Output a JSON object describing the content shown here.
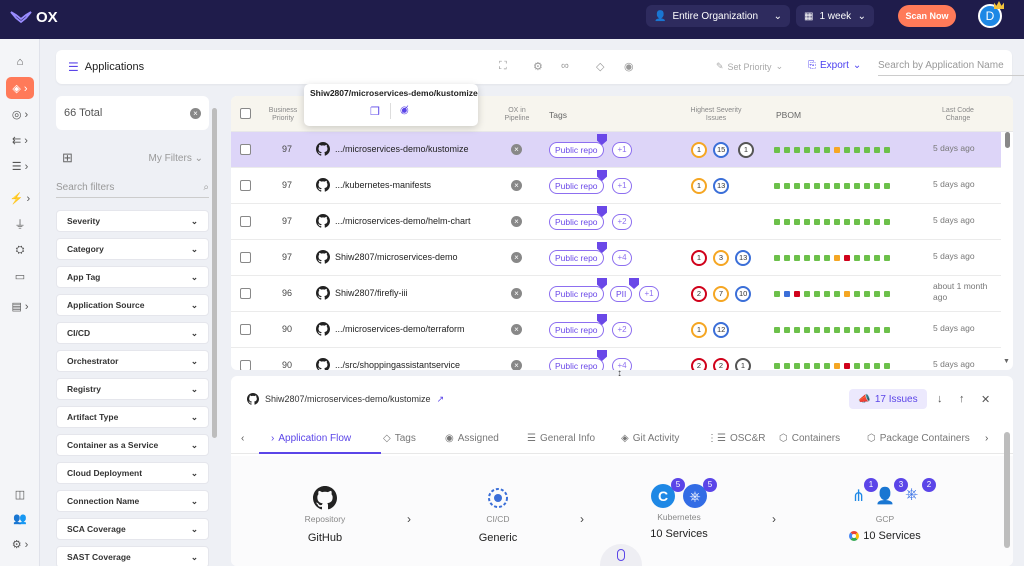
{
  "topbar": {
    "brand": "OX",
    "org_selector": "Entire Organization",
    "period_selector": "1 week",
    "scan_label": "Scan Now",
    "avatar_initial": "D"
  },
  "header": {
    "title": "Applications",
    "set_priority": "Set Priority",
    "export": "Export",
    "search_placeholder": "Search by Application Name"
  },
  "filters": {
    "total": "66 Total",
    "my_filters": "My Filters",
    "search_placeholder": "Search filters",
    "items": [
      "Severity",
      "Category",
      "App Tag",
      "Application Source",
      "CI/CD",
      "Orchestrator",
      "Registry",
      "Artifact Type",
      "Container as a Service",
      "Cloud Deployment",
      "Connection Name",
      "SCA Coverage",
      "SAST Coverage"
    ]
  },
  "table": {
    "headers": {
      "priority_l1": "Business",
      "priority_l2": "Priority",
      "pipeline_l1": "OX in",
      "pipeline_l2": "Pipeline",
      "tags": "Tags",
      "severity_l1": "Highest Severity",
      "severity_l2": "Issues",
      "pbom": "PBOM",
      "last_l1": "Last Code",
      "last_l2": "Change"
    },
    "rows": [
      {
        "priority": "97",
        "name": ".../microservices-demo/kustomize",
        "tag": "Public repo",
        "tag2": "",
        "more": "+1",
        "sev": [
          "1",
          "15",
          "1"
        ],
        "last": "5 days ago"
      },
      {
        "priority": "97",
        "name": ".../kubernetes-manifests",
        "tag": "Public repo",
        "tag2": "",
        "more": "+1",
        "sev": [
          "1",
          "13"
        ],
        "last": "5 days ago"
      },
      {
        "priority": "97",
        "name": ".../microservices-demo/helm-chart",
        "tag": "Public repo",
        "tag2": "",
        "more": "+2",
        "sev": [],
        "last": "5 days ago"
      },
      {
        "priority": "97",
        "name": "Shiw2807/microservices-demo",
        "tag": "Public repo",
        "tag2": "",
        "more": "+4",
        "sev": [
          "1",
          "3",
          "13"
        ],
        "last": "5 days ago"
      },
      {
        "priority": "96",
        "name": "Shiw2807/firefly-iii",
        "tag": "Public repo",
        "tag2": "PII",
        "more": "+1",
        "sev": [
          "2",
          "7",
          "10"
        ],
        "last": "about 1 month ago"
      },
      {
        "priority": "90",
        "name": ".../microservices-demo/terraform",
        "tag": "Public repo",
        "tag2": "",
        "more": "+2",
        "sev": [
          "1",
          "12"
        ],
        "last": "5 days ago"
      },
      {
        "priority": "90",
        "name": ".../src/shoppingassistantservice",
        "tag": "Public repo",
        "tag2": "",
        "more": "+4",
        "sev": [
          "2",
          "2",
          "1"
        ],
        "last": "5 days ago"
      }
    ]
  },
  "tooltip": {
    "title": "Shiw2807/microservices-demo/kustomize"
  },
  "detail": {
    "title": "Shiw2807/microservices-demo/kustomize",
    "issues": "17 Issues",
    "tabs": [
      "Application Flow",
      "Tags",
      "Assigned",
      "General Info",
      "Git Activity",
      "OSC&R",
      "Containers",
      "Package Containers"
    ],
    "flow": {
      "repo_label": "Repository",
      "repo_value": "GitHub",
      "cicd_label": "CI/CD",
      "cicd_value": "Generic",
      "k8s_label": "Kubernetes",
      "k8s_value": "10 Services",
      "k8s_badge1": "5",
      "k8s_badge2": "5",
      "gcp_label": "GCP",
      "gcp_value": "10 Services",
      "gcp_badge1": "1",
      "gcp_badge2": "3",
      "gcp_badge3": "2"
    }
  },
  "colors": {
    "topbar": "#1f1c4b",
    "accent": "#5b45e8",
    "scan": "#ff7a59",
    "selected_row": "#ddd5f8"
  }
}
